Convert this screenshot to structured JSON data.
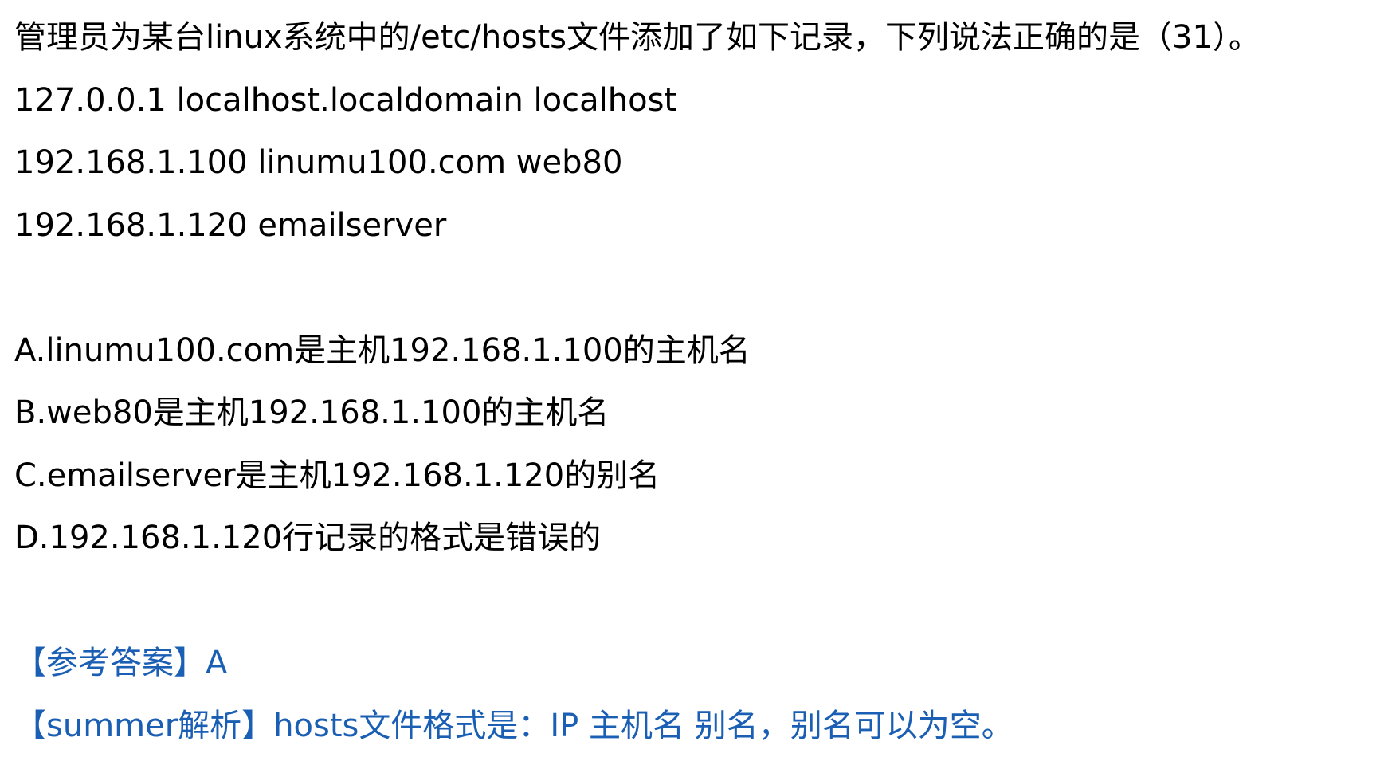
{
  "question": {
    "stem": "管理员为某台linux系统中的/etc/hosts文件添加了如下记录，下列说法正确的是（31）。",
    "records": [
      "127.0.0.1 localhost.localdomain localhost",
      "192.168.1.100 linumu100.com web80",
      "192.168.1.120 emailserver"
    ],
    "options": [
      "A.linumu100.com是主机192.168.1.100的主机名",
      "B.web80是主机192.168.1.100的主机名",
      "C.emailserver是主机192.168.1.120的别名",
      "D.192.168.1.120行记录的格式是错误的"
    ]
  },
  "answer": {
    "reference_label": "【参考答案】",
    "reference_value": "A",
    "analysis_label": "【summer解析】",
    "analysis_text": "hosts文件格式是：IP 主机名 别名，别名可以为空。"
  },
  "colors": {
    "text": "#000000",
    "answer": "#1a5fb4",
    "background": "#ffffff"
  }
}
